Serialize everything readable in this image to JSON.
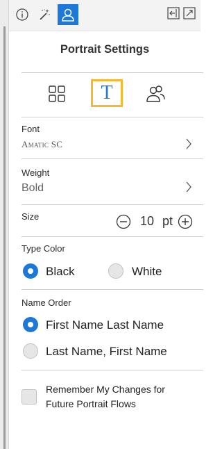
{
  "panel": {
    "title": "Portrait Settings",
    "font": {
      "label": "Font",
      "value": "Amatic SC"
    },
    "weight": {
      "label": "Weight",
      "value": "Bold"
    },
    "size": {
      "label": "Size",
      "value": "10",
      "unit": "pt"
    },
    "type_color": {
      "label": "Type Color",
      "options": [
        "Black",
        "White"
      ],
      "selected": "Black"
    },
    "name_order": {
      "label": "Name Order",
      "options": [
        "First Name Last Name",
        "Last Name, First Name"
      ],
      "selected": "First Name Last Name"
    },
    "remember": {
      "label": "Remember My Changes for Future Portrait Flows",
      "checked": false
    }
  },
  "toolbar": {
    "icons": [
      "info-icon",
      "magic-wand-icon",
      "portrait-person-icon",
      "collapse-panel-icon",
      "expand-icon"
    ]
  },
  "tabs": {
    "icons": [
      "grid-icon",
      "text-type-icon",
      "people-icon"
    ],
    "active": "text-type-icon"
  },
  "colors": {
    "accent": "#1e78d7",
    "highlight": "#f5b82e"
  }
}
